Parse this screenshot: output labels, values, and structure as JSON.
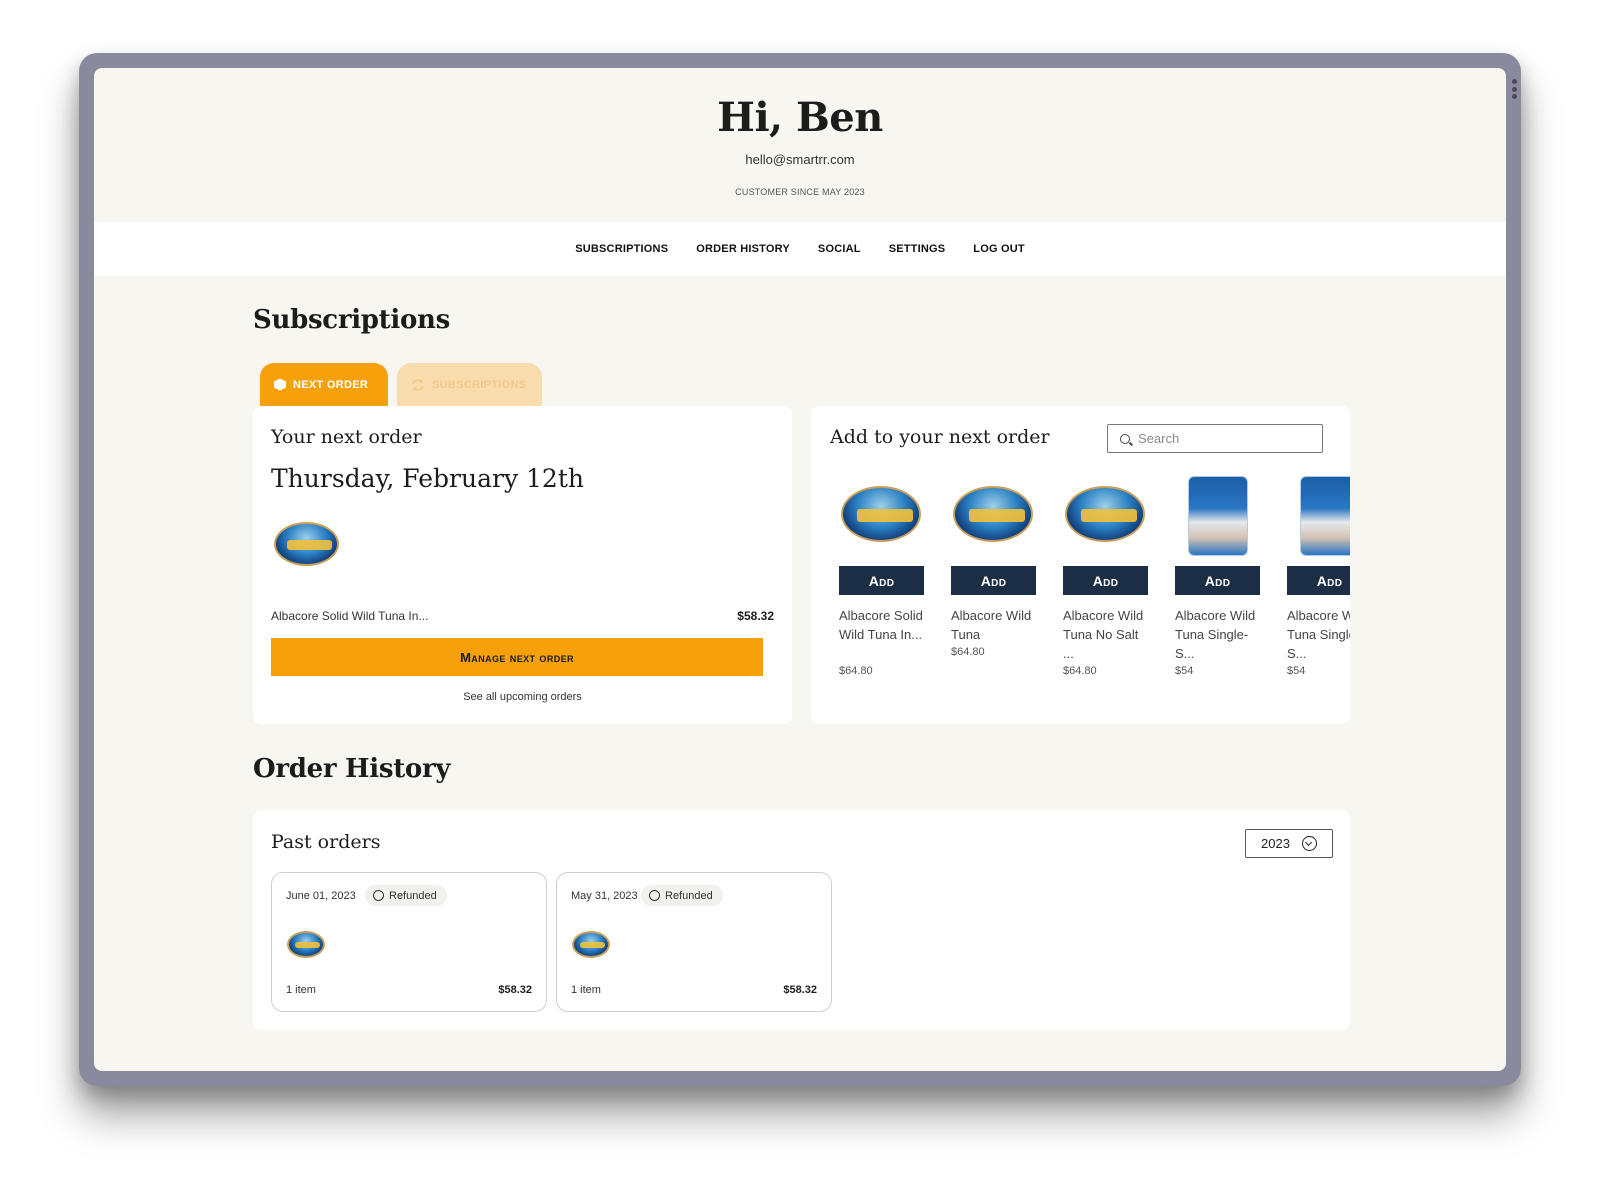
{
  "hero": {
    "greeting": "Hi, Ben",
    "email": "hello@smartrr.com",
    "since": "CUSTOMER SINCE MAY 2023"
  },
  "nav": {
    "items": [
      "SUBSCRIPTIONS",
      "ORDER HISTORY",
      "SOCIAL",
      "SETTINGS",
      "LOG OUT"
    ]
  },
  "subscriptions": {
    "title": "Subscriptions",
    "tabs": [
      {
        "label": "NEXT ORDER",
        "active": true
      },
      {
        "label": "SUBSCRIPTIONS",
        "active": false
      }
    ],
    "next_order": {
      "heading": "Your next order",
      "date": "Thursday, February 12th",
      "item_name": "Albacore Solid Wild Tuna In...",
      "item_price": "$58.32",
      "manage_label": "Manage next order",
      "see_all": "See all upcoming orders"
    },
    "add_panel": {
      "heading": "Add to your next order",
      "search_placeholder": "Search",
      "add_label": "Add",
      "products": [
        {
          "name": "Albacore Solid Wild Tuna In...",
          "price": "$64.80",
          "image": "tuna-can-icon"
        },
        {
          "name": "Albacore Wild Tuna",
          "price": "$64.80",
          "image": "tuna-can-icon"
        },
        {
          "name": "Albacore Wild Tuna No Salt ...",
          "price": "$64.80",
          "image": "tuna-can-icon"
        },
        {
          "name": "Albacore Wild Tuna Single-S...",
          "price": "$54",
          "image": "tuna-pouch-icon"
        },
        {
          "name": "Albacore Wild Tuna Single-S...",
          "price": "$54",
          "image": "tuna-pouch-icon"
        }
      ]
    }
  },
  "order_history": {
    "title": "Order History",
    "panel_title": "Past orders",
    "year": "2023",
    "orders": [
      {
        "date": "June 01, 2023",
        "status": "Refunded",
        "items": "1 item",
        "total": "$58.32"
      },
      {
        "date": "May 31, 2023",
        "status": "Refunded",
        "items": "1 item",
        "total": "$58.32"
      }
    ]
  },
  "colors": {
    "accent": "#f6a00c",
    "accent_light": "#f8dcae",
    "button_dark": "#1c2e45",
    "page_bg": "#f7f6f1"
  }
}
